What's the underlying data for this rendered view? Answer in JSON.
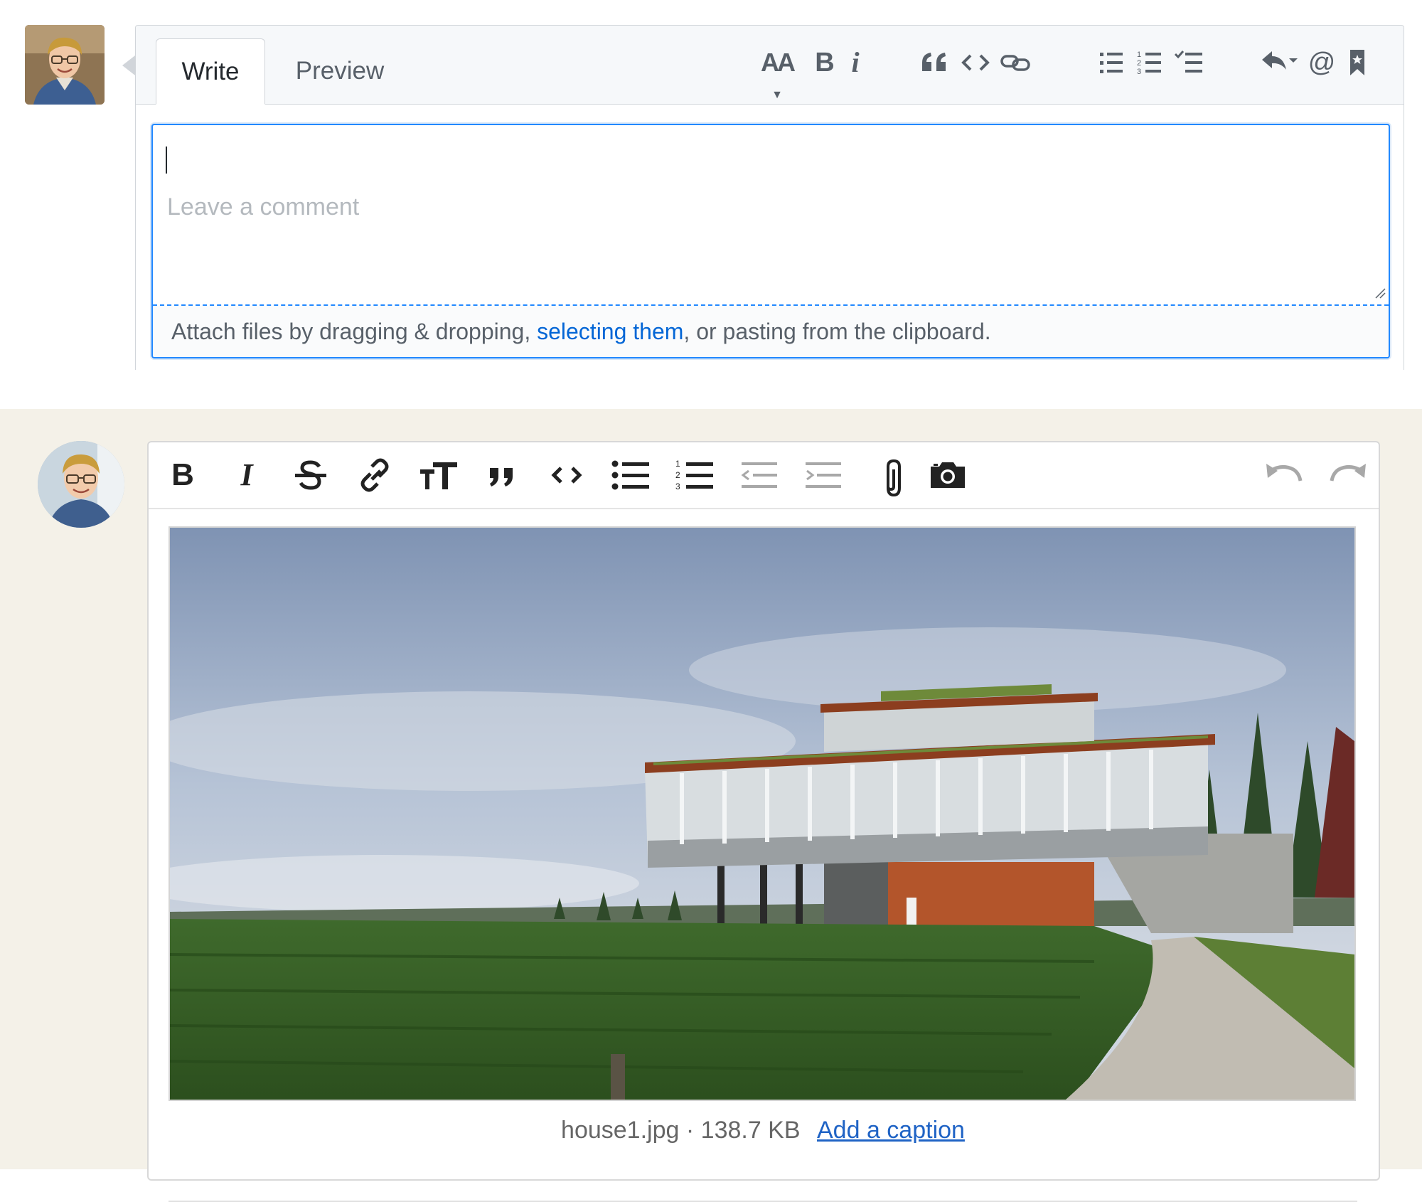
{
  "top_editor": {
    "tabs": [
      {
        "label": "Write"
      },
      {
        "label": "Preview"
      }
    ],
    "toolbar": {
      "header_label": "AA",
      "bold_label": "B",
      "italic_label": "i",
      "mention_label": "@"
    },
    "comment": {
      "placeholder": "Leave a comment",
      "value": ""
    },
    "attach": {
      "before": "Attach files by dragging & dropping, ",
      "link": "selecting them",
      "after": ", or pasting from the clipboard."
    }
  },
  "bottom_editor": {
    "toolbar": {
      "bold_label": "B",
      "italic_label": "I"
    },
    "attachment": {
      "filename": "house1.jpg",
      "separator": "·",
      "size": "138.7 KB",
      "caption_link": "Add a caption"
    }
  },
  "colors": {
    "accent_blue": "#2188ff",
    "link_blue": "#0366d6",
    "caption_link": "#1f63c5",
    "bottom_bg": "#f4f1e8"
  }
}
